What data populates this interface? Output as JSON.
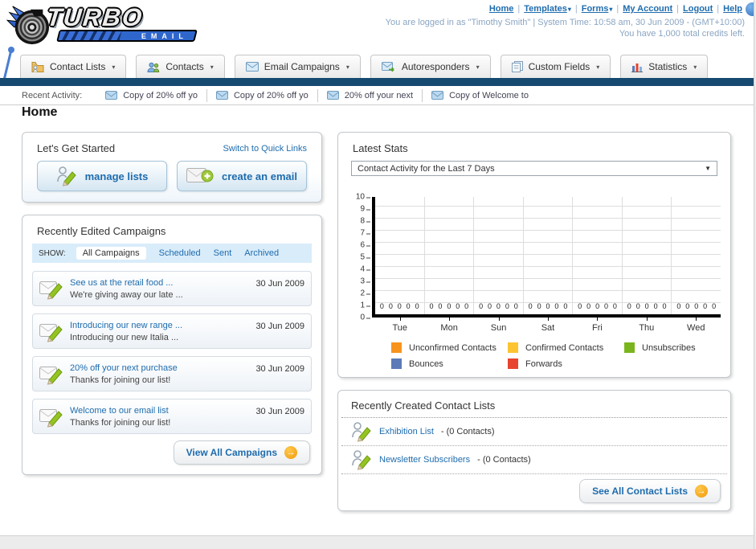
{
  "colors": {
    "link_blue": "#1e6cae",
    "navy_bar": "#174a70",
    "show_strip_bg": "#d9ecfa",
    "orange_arrow": "#f09a0a"
  },
  "header": {
    "logo_line1": "TURBO",
    "logo_line2": "EMAIL",
    "nav": [
      {
        "label": "Home",
        "dropdown": false
      },
      {
        "label": "Templates",
        "dropdown": true
      },
      {
        "label": "Forms",
        "dropdown": true
      },
      {
        "label": "My Account",
        "dropdown": false
      },
      {
        "label": "Logout",
        "dropdown": false
      },
      {
        "label": "Help",
        "dropdown": false
      }
    ],
    "login_line": "You are logged in as \"Timothy Smith\" | System Time: 10:58 am, 30 Jun 2009 - (GMT+10:00)",
    "credits_line": "You have 1,000 total credits left."
  },
  "main_tabs": [
    {
      "label": "Contact Lists",
      "icon": "folder-user-icon"
    },
    {
      "label": "Contacts",
      "icon": "users-icon"
    },
    {
      "label": "Email Campaigns",
      "icon": "envelope-icon"
    },
    {
      "label": "Autoresponders",
      "icon": "envelope-arrow-icon"
    },
    {
      "label": "Custom Fields",
      "icon": "pages-icon"
    },
    {
      "label": "Statistics",
      "icon": "bar-chart-icon"
    }
  ],
  "recent_activity": {
    "label": "Recent Activity:",
    "items": [
      "Copy of 20% off yo",
      "Copy of 20% off yo",
      "20% off your next",
      "Copy of Welcome to"
    ]
  },
  "page_title": "Home",
  "get_started": {
    "title": "Let's Get Started",
    "switch_link": "Switch to Quick Links",
    "buttons": [
      {
        "label": "manage lists",
        "icon": "user-pencil-icon"
      },
      {
        "label": "create an email",
        "icon": "envelope-plus-icon"
      }
    ]
  },
  "campaigns": {
    "title": "Recently Edited Campaigns",
    "show_label": "SHOW:",
    "filters": [
      "All Campaigns",
      "Scheduled",
      "Sent",
      "Archived"
    ],
    "active_filter": "All Campaigns",
    "items": [
      {
        "title": "See us at the retail food ...",
        "subtitle": "We're giving away our late ...",
        "date": "30 Jun 2009"
      },
      {
        "title": "Introducing our new range ...",
        "subtitle": "Introducing our new Italia ...",
        "date": "30 Jun 2009"
      },
      {
        "title": "20% off your next purchase",
        "subtitle": "Thanks for joining our list!",
        "date": "30 Jun 2009"
      },
      {
        "title": "Welcome to our email list",
        "subtitle": "Thanks for joining our list!",
        "date": "30 Jun 2009"
      }
    ],
    "view_all_label": "View All Campaigns"
  },
  "latest_stats": {
    "title": "Latest Stats",
    "selected_option": "Contact Activity for the Last 7 Days",
    "chart_data": {
      "type": "bar",
      "categories": [
        "Tue",
        "Mon",
        "Sun",
        "Sat",
        "Fri",
        "Thu",
        "Wed"
      ],
      "series": [
        {
          "name": "Unconfirmed Contacts",
          "color": "#f7941d",
          "values": [
            0,
            0,
            0,
            0,
            0,
            0,
            0
          ]
        },
        {
          "name": "Confirmed Contacts",
          "color": "#fdc431",
          "values": [
            0,
            0,
            0,
            0,
            0,
            0,
            0
          ]
        },
        {
          "name": "Unsubscribes",
          "color": "#7ab51d",
          "values": [
            0,
            0,
            0,
            0,
            0,
            0,
            0
          ]
        },
        {
          "name": "Bounces",
          "color": "#5c7ab8",
          "values": [
            0,
            0,
            0,
            0,
            0,
            0,
            0
          ]
        },
        {
          "name": "Forwards",
          "color": "#e8432e",
          "values": [
            0,
            0,
            0,
            0,
            0,
            0,
            0
          ]
        }
      ],
      "ylim": [
        0,
        10
      ],
      "yticks": [
        0,
        1,
        2,
        3,
        4,
        5,
        6,
        7,
        8,
        9,
        10
      ],
      "grid": true,
      "legend_position": "bottom"
    }
  },
  "contact_lists": {
    "title": "Recently Created Contact Lists",
    "items": [
      {
        "name": "Exhibition List",
        "detail": "- (0 Contacts)"
      },
      {
        "name": "Newsletter Subscribers",
        "detail": "- (0 Contacts)"
      }
    ],
    "see_all_label": "See All Contact Lists"
  }
}
